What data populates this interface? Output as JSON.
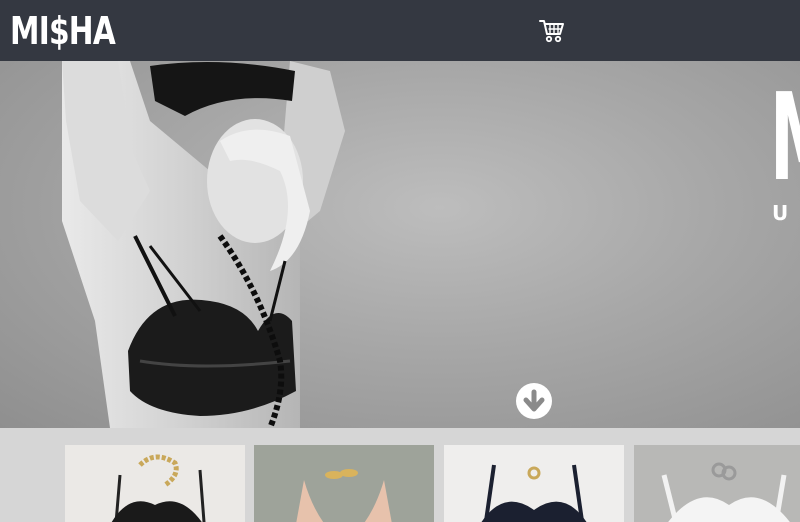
{
  "header": {
    "logo_text": "MI$HA",
    "cart_icon": "shopping-cart-icon"
  },
  "hero": {
    "title": "M",
    "subtitle": "U",
    "scroll_icon": "arrow-down-circle-icon"
  },
  "products": [
    {
      "name": "black-bra-gold-necklace"
    },
    {
      "name": "nude-bra-gold-clips"
    },
    {
      "name": "navy-bra-gold-ring"
    },
    {
      "name": "white-bra-silver-rings"
    }
  ]
}
